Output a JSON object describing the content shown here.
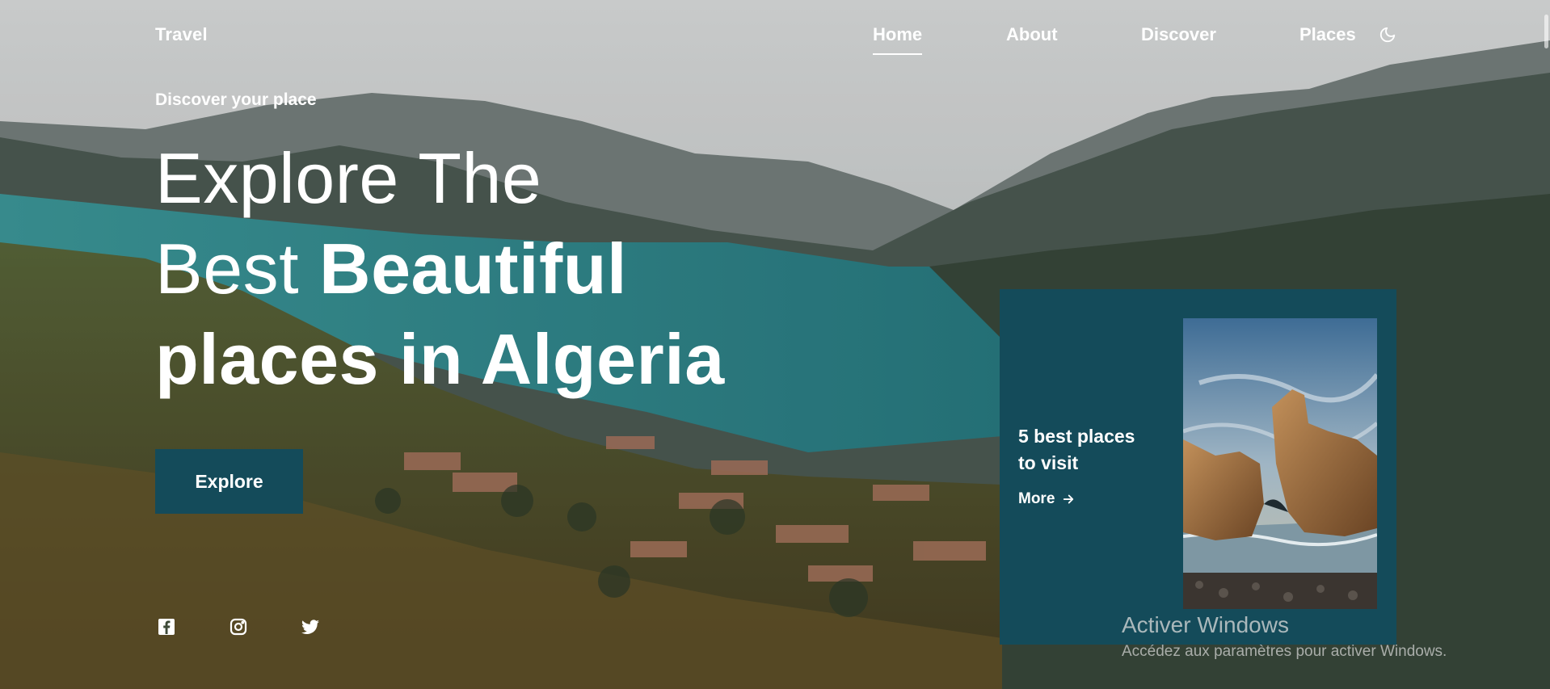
{
  "nav": {
    "logo": "Travel",
    "items": [
      {
        "label": "Home",
        "active": true
      },
      {
        "label": "About",
        "active": false
      },
      {
        "label": "Discover",
        "active": false
      },
      {
        "label": "Places",
        "active": false
      }
    ],
    "theme_icon": "moon-icon"
  },
  "hero": {
    "subtitle": "Discover your place",
    "title_line1": "Explore The",
    "title_line2_light": "Best ",
    "title_line2_bold": "Beautiful",
    "title_line3": "places in Algeria",
    "button_label": "Explore"
  },
  "social": {
    "icons": [
      "facebook-icon",
      "instagram-icon",
      "twitter-icon"
    ]
  },
  "card": {
    "title": "5 best places to visit",
    "more_label": "More",
    "more_icon": "arrow-right-icon"
  },
  "watermark": {
    "title": "Activer Windows",
    "subtitle": "Accédez aux paramètres pour activer Windows."
  },
  "colors": {
    "accent": "#144b5a",
    "text": "#ffffff"
  }
}
